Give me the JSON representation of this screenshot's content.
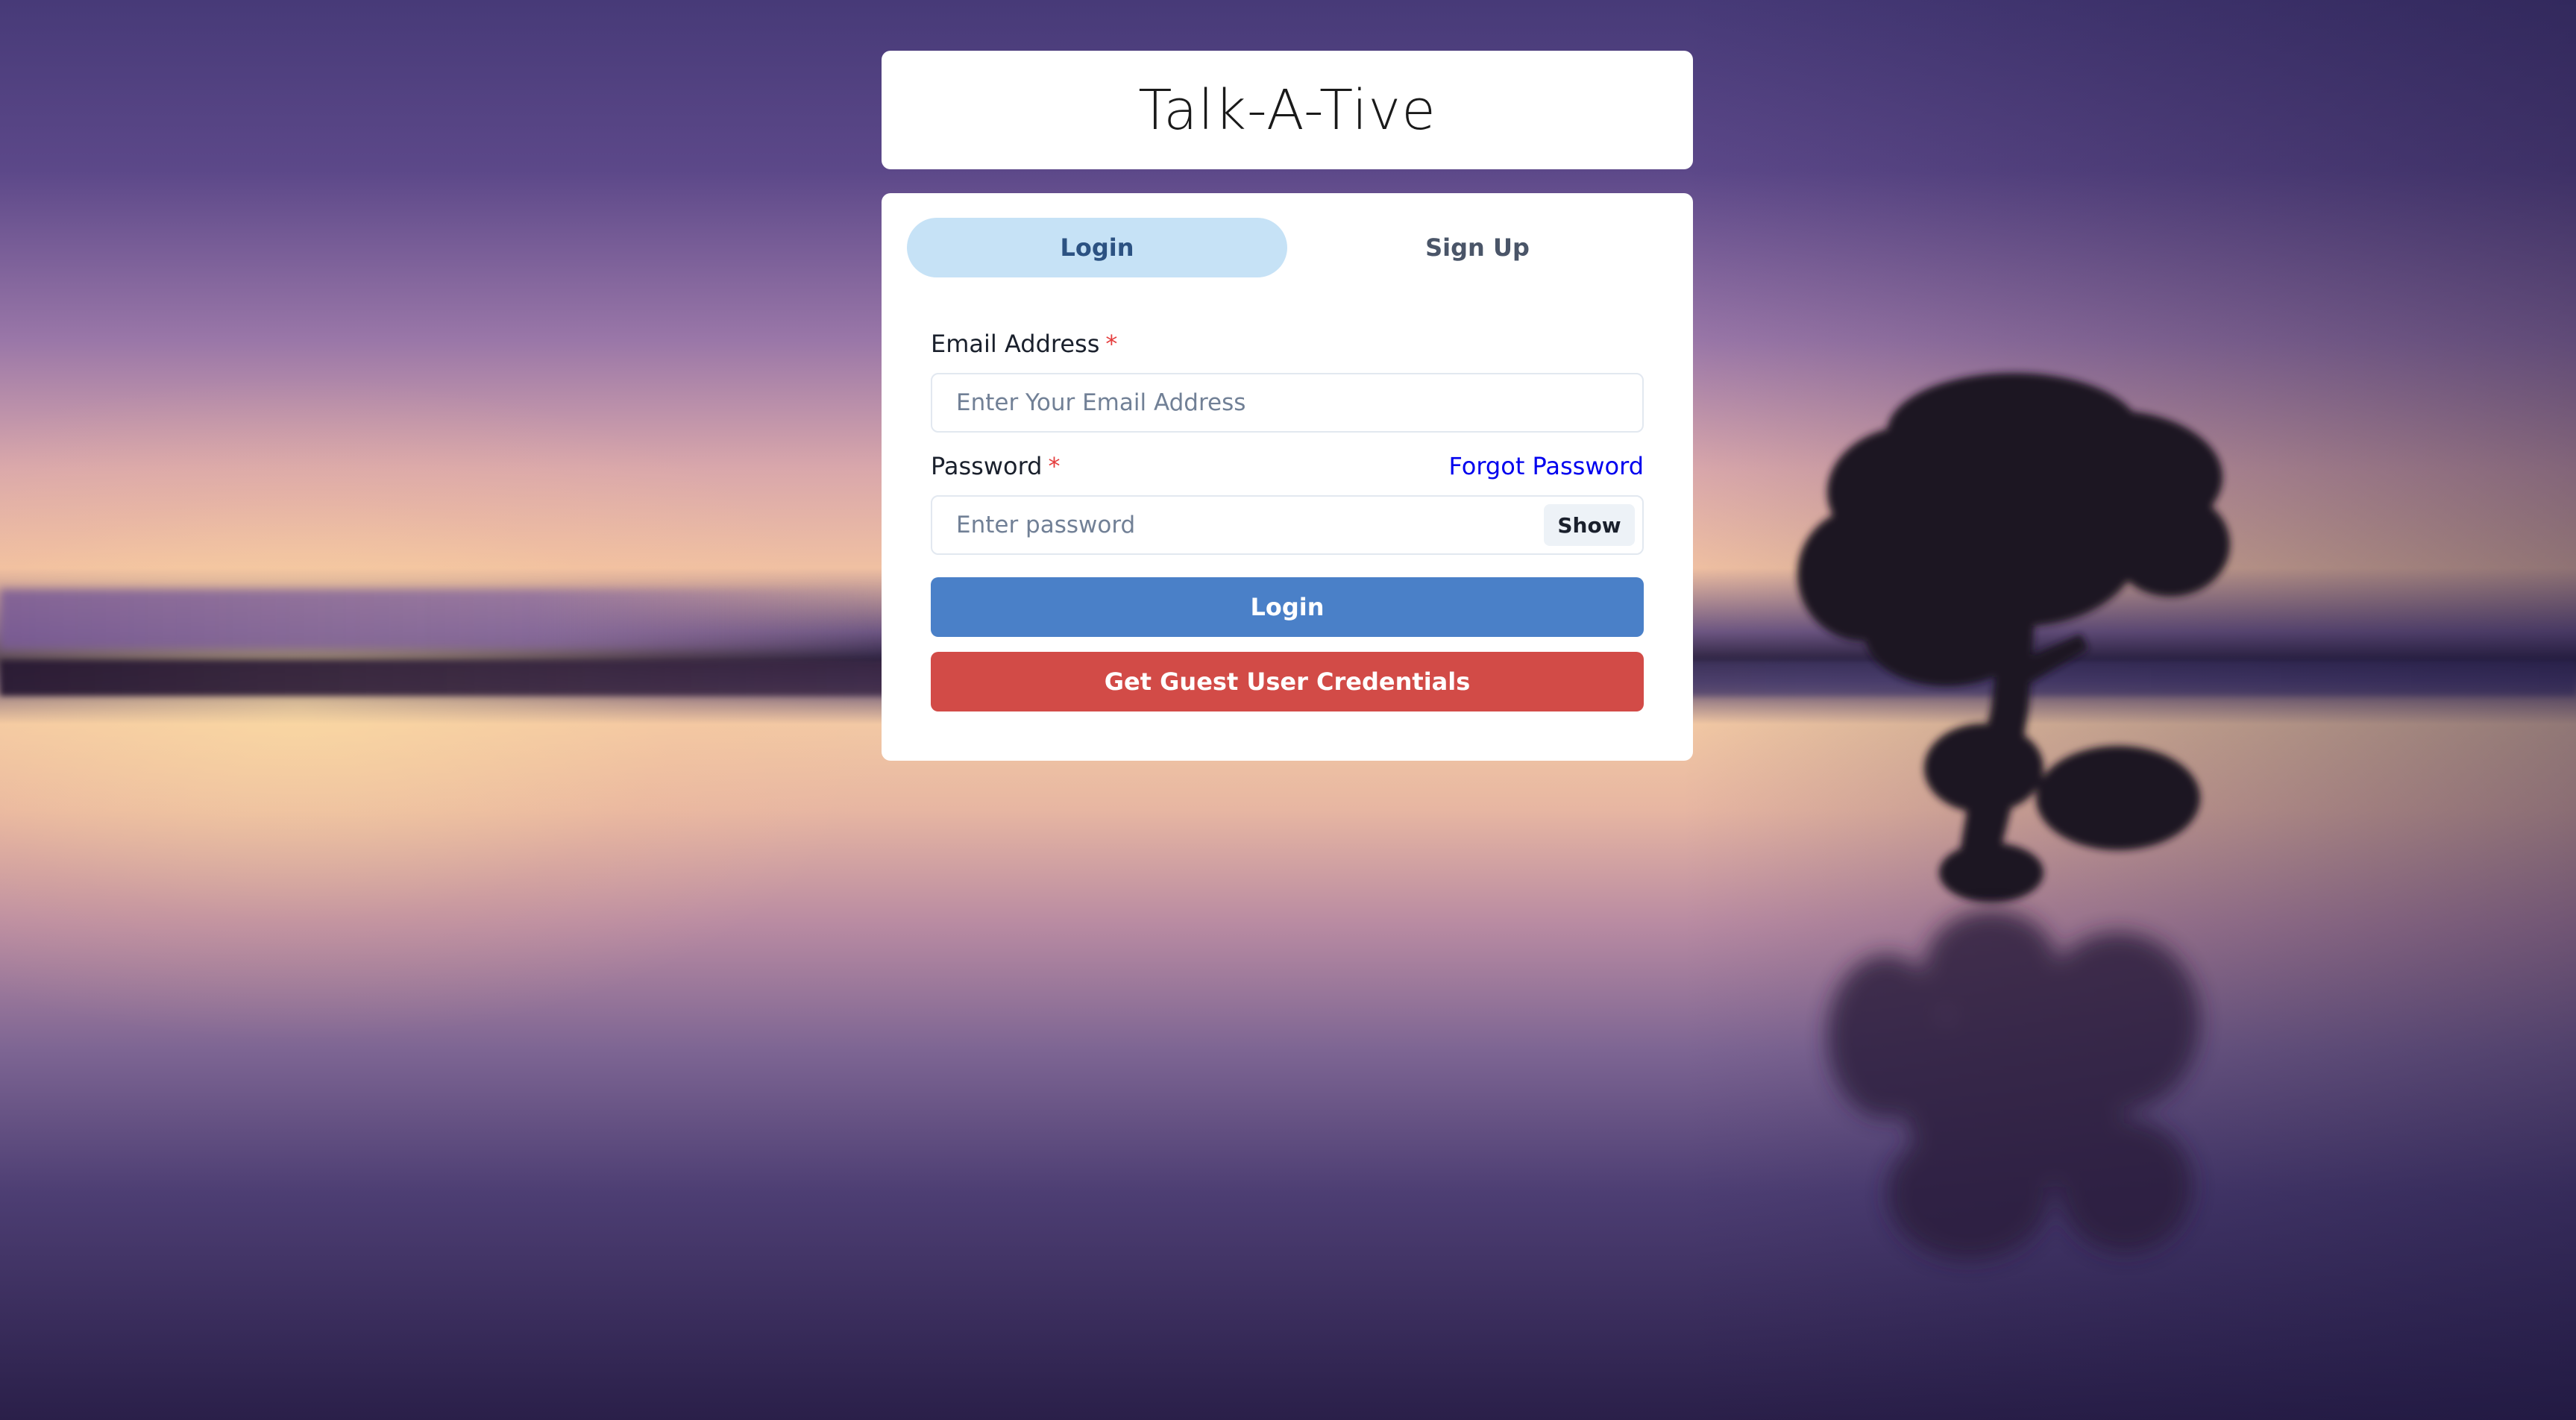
{
  "app": {
    "title": "Talk-A-Tive"
  },
  "tabs": [
    {
      "label": "Login",
      "active": true
    },
    {
      "label": "Sign Up",
      "active": false
    }
  ],
  "login_form": {
    "email": {
      "label": "Email Address",
      "required_marker": "*",
      "placeholder": "Enter Your Email Address",
      "value": ""
    },
    "password": {
      "label": "Password",
      "required_marker": "*",
      "placeholder": "Enter password",
      "value": "",
      "toggle_label": "Show"
    },
    "forgot_password_label": "Forgot Password",
    "submit_label": "Login",
    "guest_label": "Get Guest User Credentials"
  },
  "colors": {
    "active_tab_bg": "#c6e2f6",
    "login_button": "#4a80c8",
    "guest_button": "#d24b47",
    "link": "#0000ee",
    "required": "#e53e3e"
  },
  "icons": {
    "background": "sunset-lake-tree-image"
  }
}
